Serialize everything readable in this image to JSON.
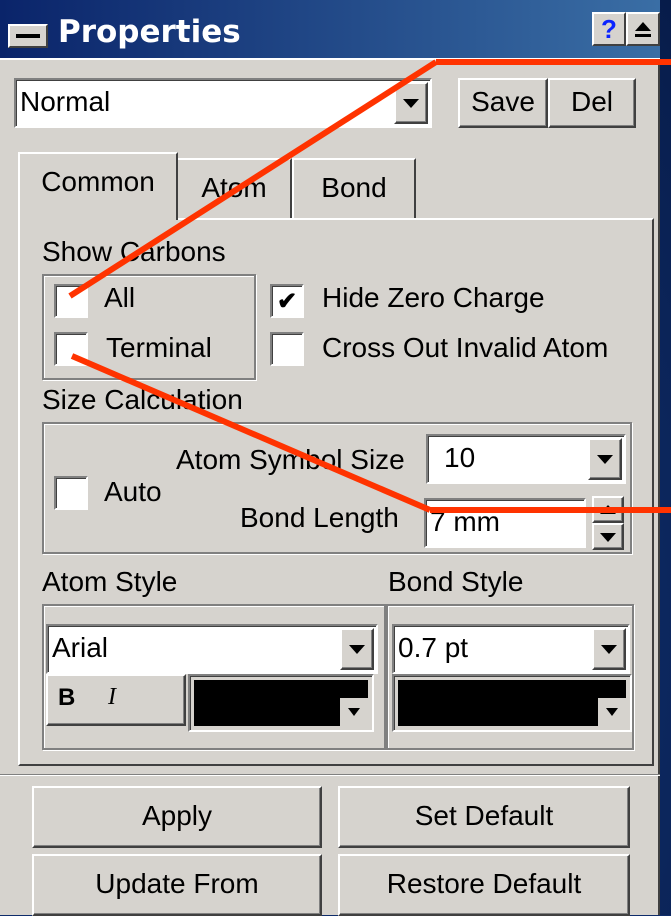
{
  "window": {
    "title": "Properties",
    "help_button": "?",
    "collapse_icon": "eject-icon"
  },
  "style_bar": {
    "style_value": "Normal",
    "save_label": "Save",
    "delete_label": "Del"
  },
  "tabs": [
    {
      "label": "Common",
      "active": true
    },
    {
      "label": "Atom",
      "active": false
    },
    {
      "label": "Bond",
      "active": false
    }
  ],
  "show_carbons": {
    "group_label": "Show Carbons",
    "all_label": "All",
    "all_checked": false,
    "terminal_label": "Terminal",
    "terminal_checked": false
  },
  "options": {
    "hide_zero_charge_label": "Hide Zero Charge",
    "hide_zero_charge_checked": true,
    "cross_out_label": "Cross Out Invalid Atom",
    "cross_out_checked": false
  },
  "size_calculation": {
    "group_label": "Size Calculation",
    "auto_label": "Auto",
    "auto_checked": false,
    "atom_symbol_size_label": "Atom Symbol Size",
    "atom_symbol_size_value": "10",
    "bond_length_label": "Bond Length",
    "bond_length_value": "7 mm"
  },
  "atom_style": {
    "label": "Atom Style",
    "font_value": "Arial",
    "bold_label": "B",
    "italic_label": "I",
    "color": "#000000"
  },
  "bond_style": {
    "label": "Bond Style",
    "width_value": "0.7 pt",
    "color": "#000000"
  },
  "actions": {
    "apply_label": "Apply",
    "set_default_label": "Set Default",
    "update_from_label": "Update From",
    "restore_default_label": "Restore Default"
  },
  "annotation_color": "#ff3300"
}
